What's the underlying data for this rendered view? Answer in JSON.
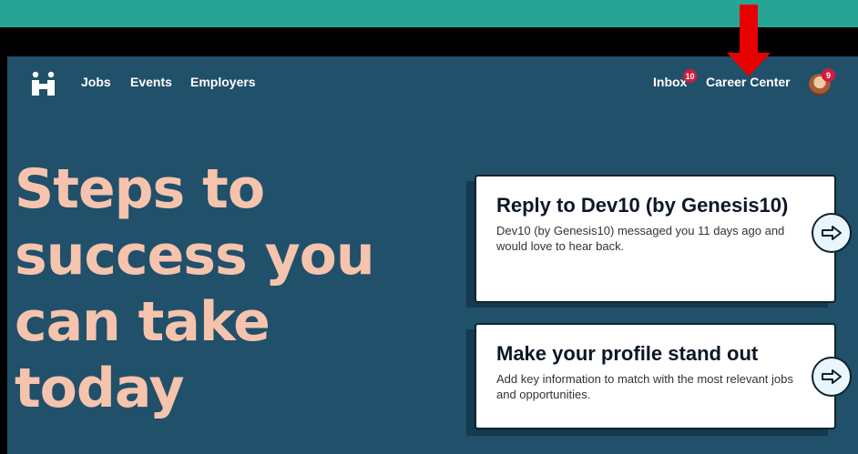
{
  "nav": {
    "logo_icon": "handshake-logo-icon",
    "links": {
      "jobs": "Jobs",
      "events": "Events",
      "employers": "Employers"
    },
    "inbox": {
      "label": "Inbox",
      "badge": "10"
    },
    "career_center": "Career Center",
    "avatar": {
      "badge": "9"
    }
  },
  "hero": {
    "lines": [
      "Steps to",
      "success you",
      "can take",
      "today"
    ]
  },
  "cards": [
    {
      "title": "Reply to Dev10 (by Genesis10)",
      "text": "Dev10 (by Genesis10) messaged you 11 days ago and would love to hear back.",
      "action_icon": "arrow-right-icon"
    },
    {
      "title": "Make your profile stand out",
      "text": "Add key information to match with the most relevant jobs and opportunities.",
      "action_icon": "arrow-right-icon"
    }
  ],
  "colors": {
    "header_band": "#26a596",
    "page_bg": "#21506a",
    "hero_text": "#f6c3ad",
    "badge": "#d21c3a",
    "annotation_arrow": "#e60000"
  }
}
